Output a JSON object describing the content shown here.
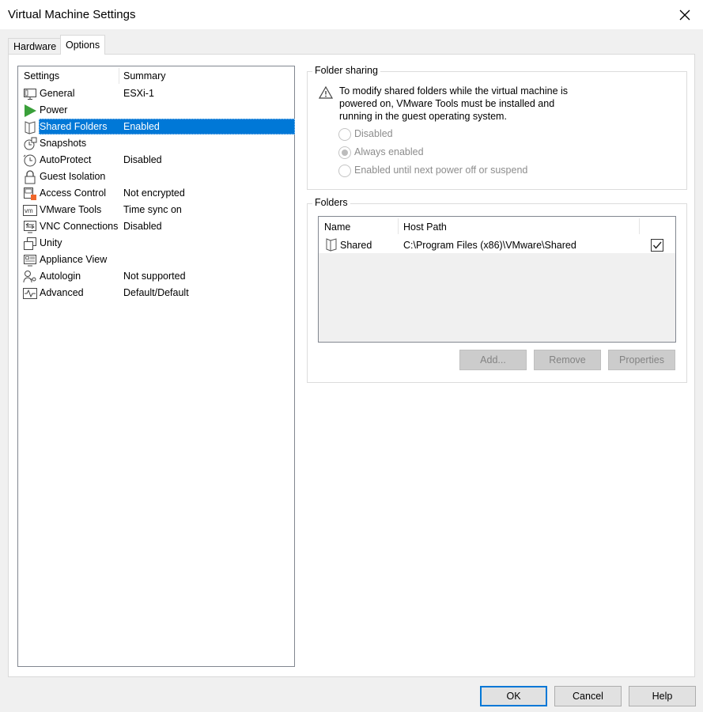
{
  "window": {
    "title": "Virtual Machine Settings"
  },
  "tabs": [
    {
      "label": "Hardware"
    },
    {
      "label": "Options"
    }
  ],
  "settings": {
    "header_setting": "Settings",
    "header_summary": "Summary",
    "selected": "Shared Folders",
    "items": [
      {
        "name": "General",
        "summary": "ESXi-1",
        "icon": "monitor-icon"
      },
      {
        "name": "Power",
        "summary": "",
        "icon": "power-play-icon"
      },
      {
        "name": "Shared Folders",
        "summary": "Enabled",
        "icon": "shared-folder-icon"
      },
      {
        "name": "Snapshots",
        "summary": "",
        "icon": "snapshot-icon"
      },
      {
        "name": "AutoProtect",
        "summary": "Disabled",
        "icon": "autoprotect-clock-icon"
      },
      {
        "name": "Guest Isolation",
        "summary": "",
        "icon": "lock-icon"
      },
      {
        "name": "Access Control",
        "summary": "Not encrypted",
        "icon": "access-control-icon"
      },
      {
        "name": "VMware Tools",
        "summary": "Time sync on",
        "icon": "vm-tools-icon"
      },
      {
        "name": "VNC Connections",
        "summary": "Disabled",
        "icon": "vnc-icon"
      },
      {
        "name": "Unity",
        "summary": "",
        "icon": "unity-icon"
      },
      {
        "name": "Appliance View",
        "summary": "",
        "icon": "appliance-view-icon"
      },
      {
        "name": "Autologin",
        "summary": "Not supported",
        "icon": "autologin-icon"
      },
      {
        "name": "Advanced",
        "summary": "Default/Default",
        "icon": "advanced-pulse-icon"
      }
    ]
  },
  "folder_sharing": {
    "title": "Folder sharing",
    "warning": "To modify shared folders while the virtual machine is powered on, VMware Tools must be installed and running in the guest operating system.",
    "warning_lines": [
      "To modify shared folders while the virtual machine is",
      "powered on, VMware Tools must be installed and",
      "running in the guest operating system."
    ],
    "options": [
      {
        "label": "Disabled",
        "checked": false
      },
      {
        "label": "Always enabled",
        "checked": true
      },
      {
        "label": "Enabled until next power off or suspend",
        "checked": false
      }
    ]
  },
  "folders": {
    "title": "Folders",
    "col_name": "Name",
    "col_host_path": "Host Path",
    "rows": [
      {
        "name": "Shared",
        "host_path": "C:\\Program Files (x86)\\VMware\\Shared",
        "enabled": true
      }
    ],
    "buttons": {
      "add": "Add...",
      "remove": "Remove",
      "properties": "Properties"
    }
  },
  "dialog_buttons": {
    "ok": "OK",
    "cancel": "Cancel",
    "help": "Help"
  },
  "colors": {
    "selection": "#0078d7",
    "power_green": "#3aa03a",
    "lock_orange": "#f0662a"
  }
}
